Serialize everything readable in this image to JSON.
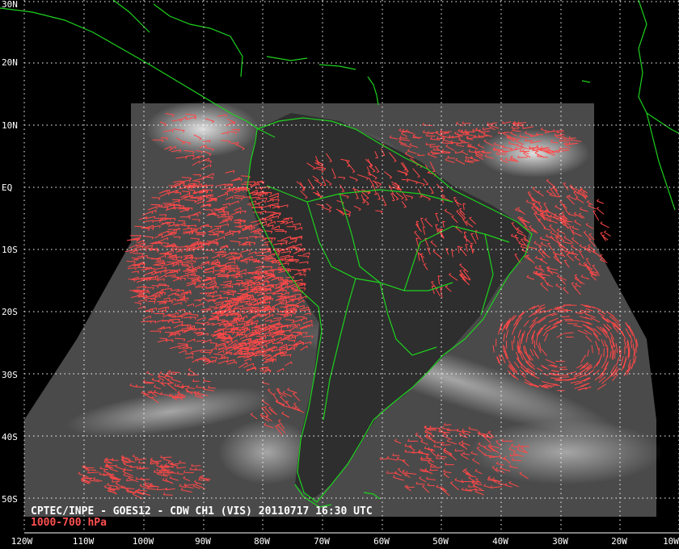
{
  "product": {
    "title": "CPTEC/INPE - GOES12 - CDW CH1 (VIS) 20110717 16:30 UTC",
    "level": "1000-700 hPa"
  },
  "grid": {
    "lat_labels": [
      "30N",
      "20N",
      "10N",
      "EQ",
      "10S",
      "20S",
      "30S",
      "40S",
      "50S"
    ],
    "lon_labels": [
      "120W",
      "110W",
      "100W",
      "90W",
      "80W",
      "70W",
      "60W",
      "50W",
      "40W",
      "30W",
      "20W",
      "10W"
    ],
    "lon_range": [
      -120,
      -10
    ],
    "lat_range": [
      30,
      -57
    ]
  },
  "colors": {
    "background": "#000000",
    "coastline": "#1ed21e",
    "grid": "#ffffff",
    "wind_vectors": "#ff4848",
    "satellite_gray": "#5a5a5a"
  },
  "legend": {
    "vector_layer": "cloud drift winds",
    "coastline_layer": "coastlines and borders"
  }
}
